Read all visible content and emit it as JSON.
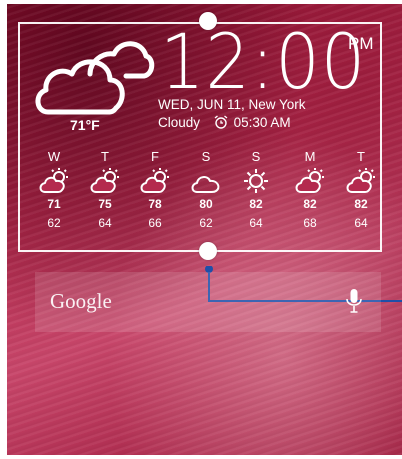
{
  "weather_widget": {
    "current_temp": "71°F",
    "time": "12:00",
    "ampm": "PM",
    "date_location": "WED, JUN 11, New York",
    "condition": "Cloudy",
    "alarm_time": "05:30 AM",
    "current_icon": "cloudy-icon",
    "forecast": [
      {
        "day": "W",
        "icon": "partly-cloudy-icon",
        "high": "71",
        "low": "62"
      },
      {
        "day": "T",
        "icon": "partly-cloudy-icon",
        "high": "75",
        "low": "64"
      },
      {
        "day": "F",
        "icon": "partly-cloudy-icon",
        "high": "78",
        "low": "66"
      },
      {
        "day": "S",
        "icon": "cloud-icon",
        "high": "80",
        "low": "62"
      },
      {
        "day": "S",
        "icon": "sun-icon",
        "high": "82",
        "low": "64"
      },
      {
        "day": "M",
        "icon": "partly-cloudy-icon",
        "high": "82",
        "low": "68"
      },
      {
        "day": "T",
        "icon": "partly-cloudy-icon",
        "high": "82",
        "low": "64"
      }
    ]
  },
  "search_widget": {
    "logo_text": "Google",
    "mic_icon": "microphone-icon"
  },
  "colors": {
    "accent_line": "#1f4fa8",
    "text": "#ffffff"
  }
}
